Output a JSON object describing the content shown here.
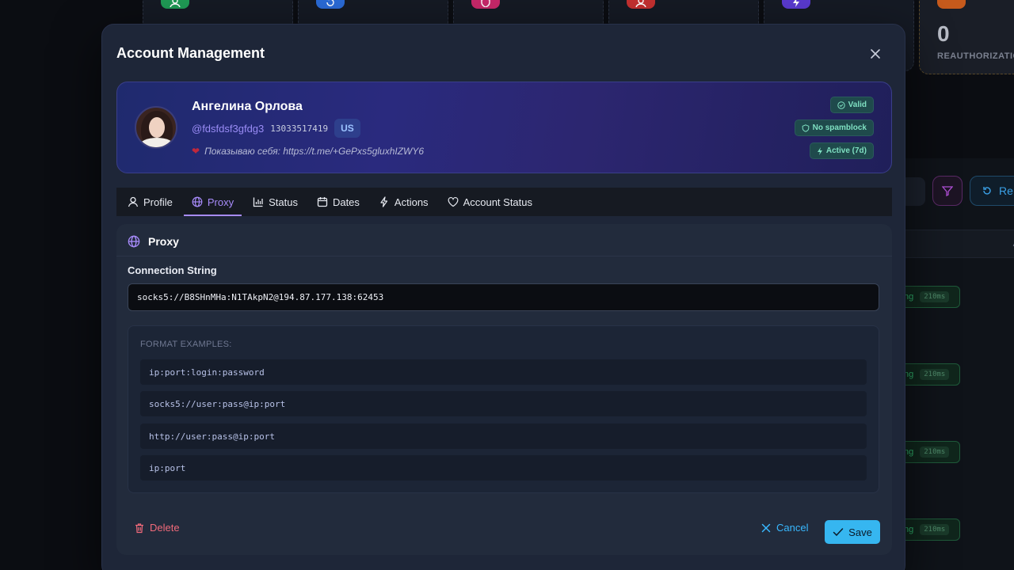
{
  "modal": {
    "title": "Account Management"
  },
  "profile": {
    "name": "Ангелина Орлова",
    "username": "@fdsfdsf3gfdg3",
    "user_id": "13033517419",
    "country": "US",
    "bio": "Показываю себя: https://t.me/+GePxs5gluxhIZWY6",
    "badges": {
      "valid": "Valid",
      "spam": "No spamblock",
      "active": "Active (7d)"
    }
  },
  "tabs": [
    {
      "label": "Profile",
      "icon": "user-icon"
    },
    {
      "label": "Proxy",
      "icon": "globe-icon"
    },
    {
      "label": "Status",
      "icon": "bar-chart-icon"
    },
    {
      "label": "Dates",
      "icon": "calendar-icon"
    },
    {
      "label": "Actions",
      "icon": "lightning-icon"
    },
    {
      "label": "Account Status",
      "icon": "heart-icon"
    }
  ],
  "active_tab": "Proxy",
  "proxy": {
    "section_title": "Proxy",
    "connection_label": "Connection String",
    "connection_value": "socks5://B8SHnMHa:N1TAkpN2@194.87.177.138:62453",
    "examples_title": "FORMAT EXAMPLES:",
    "examples": [
      "ip:port:login:password",
      "socks5://user:pass@ip:port",
      "http://user:pass@ip:port",
      "ip:port"
    ]
  },
  "actions": {
    "delete": "Delete",
    "cancel": "Cancel",
    "save": "Save"
  },
  "background": {
    "stat_number": "0",
    "stat_label": "REAUTHORIZATION",
    "refresh_label": "Re",
    "table_header_fragment": "A",
    "status_fragment": "ng",
    "latency": "210ms"
  },
  "colors": {
    "accent_purple": "#a78bfa",
    "accent_blue": "#36b6f0",
    "danger": "#f06a7a",
    "badge_green": "#7fe0c2"
  }
}
